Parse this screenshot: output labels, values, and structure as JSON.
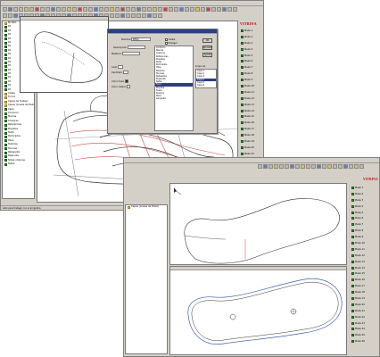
{
  "back_window": {
    "brand": "VITRINA",
    "tree": {
      "items": [
        {
          "label": "Modelo",
          "icon": "folder-icon"
        },
        {
          "label": "Pd",
          "icon": "layer-icon"
        },
        {
          "label": "Pd",
          "icon": "layer-icon"
        },
        {
          "label": "Pd",
          "icon": "layer-icon"
        },
        {
          "label": "Pd",
          "icon": "layer-icon"
        },
        {
          "label": "Pd",
          "icon": "layer-icon"
        },
        {
          "label": "Pd",
          "icon": "layer-icon"
        },
        {
          "label": "Pd",
          "icon": "layer-icon"
        },
        {
          "label": "Pd",
          "icon": "layer-icon"
        },
        {
          "label": "Pd",
          "icon": "layer-icon"
        },
        {
          "label": "Pd",
          "icon": "layer-icon"
        },
        {
          "label": "Pd",
          "icon": "layer-icon"
        },
        {
          "label": "Pd",
          "icon": "layer-icon"
        },
        {
          "label": "Pd",
          "icon": "layer-icon"
        },
        {
          "label": "Pd",
          "icon": "layer-icon"
        },
        {
          "label": "Pd",
          "icon": "layer-icon"
        },
        {
          "label": "Pd",
          "icon": "layer-icon"
        },
        {
          "label": "Pd",
          "icon": "layer-icon"
        },
        {
          "label": "Vistas",
          "icon": "folder-icon"
        },
        {
          "label": "Forros",
          "icon": "folder-icon"
        },
        {
          "label": "Capas de Trabajo",
          "icon": "folder-icon"
        },
        {
          "label": "Capas (Lineas de Pieza)",
          "icon": "folder-icon"
        },
        {
          "label": "Capa",
          "icon": "layer-icon"
        },
        {
          "label": "Contorno",
          "icon": "layer-icon"
        },
        {
          "label": "Marcas",
          "icon": "layer-icon"
        },
        {
          "label": "Costuras",
          "icon": "layer-icon"
        },
        {
          "label": "Referencias",
          "icon": "layer-icon"
        },
        {
          "label": "Piquetes",
          "icon": "layer-icon"
        },
        {
          "label": "Texto",
          "icon": "layer-icon"
        },
        {
          "label": "Perforados",
          "icon": "layer-icon"
        },
        {
          "label": "Hilos",
          "icon": "layer-icon"
        },
        {
          "label": "Taladros",
          "icon": "layer-icon"
        },
        {
          "label": "Tacones",
          "icon": "layer-icon"
        },
        {
          "label": "Rebajados",
          "icon": "layer-icon"
        },
        {
          "label": "Pespunte",
          "icon": "layer-icon"
        },
        {
          "label": "Notas internas",
          "icon": "layer-icon"
        },
        {
          "label": "Notas",
          "icon": "layer-icon"
        }
      ]
    },
    "right_panel": {
      "items": [
        "Pieza 1",
        "Pieza 2",
        "Pieza 3",
        "Pieza 4",
        "Pieza 5",
        "Pieza 6",
        "Pieza 7",
        "Pieza 8",
        "Pieza 9",
        "Pieza 10",
        "Pieza 11",
        "Pieza 12",
        "Pieza 13",
        "Pieza 14",
        "Pieza 15",
        "Pieza 16",
        "Pieza 17",
        "Pieza 18",
        "Pieza 19",
        "Pieza 20",
        "Pieza 21",
        "Pieza 22",
        "Pieza 23",
        "Pieza 24",
        "Pieza 25",
        "Pieza 26",
        "Pieza 27",
        "Pieza 28"
      ]
    },
    "status": "Listo para trabajar con el programa"
  },
  "dialog": {
    "fields": {
      "name_label": "Nombre",
      "name_value": "PIEZA",
      "desc_label": "Descripción",
      "material_label": "Material",
      "side_label": "Lado",
      "qty_label": "Cantidad",
      "color_label": "Color línea",
      "fill_label": "Color relleno"
    },
    "checks": {
      "visible": "Visible",
      "protect": "Proteger"
    },
    "buttons": {
      "ok": "OK",
      "cancel": "Cancelar",
      "help": "Ayuda"
    },
    "list": [
      "Contorno",
      "Marcas",
      "Costuras",
      "Referencias",
      "Piquetes",
      "Texto",
      "Perforados",
      "Hilos",
      "Taladros",
      "Tacones",
      "Rebajados",
      "Pespunte",
      "Notas",
      "Forro",
      "Plantilla",
      "Suela",
      "Puntera",
      "Talón",
      "Lengüeta"
    ],
    "list_selected_index": 13,
    "list2_label": "Grupo de",
    "list2": [
      "Capa 1",
      "Capa 2",
      "Capa 3",
      "Capa 4",
      "Capa 5",
      "Capa 6"
    ],
    "list2_selected_index": 3
  },
  "front_window": {
    "brand": "VITRINA",
    "tree_item": "Capas (Lineas de Pieza)",
    "right_panel": {
      "items": [
        "Pieza 1",
        "Pieza 2",
        "Pieza 3",
        "Pieza 4",
        "Pieza 5",
        "Pieza 6",
        "Pieza 7",
        "Pieza 8",
        "Pieza 9",
        "Pieza 10",
        "Pieza 11",
        "Pieza 12",
        "Pieza 13",
        "Pieza 14",
        "Pieza 15",
        "Pieza 16",
        "Pieza 17",
        "Pieza 18",
        "Pieza 19",
        "Pieza 20",
        "Pieza 21",
        "Pieza 22",
        "Pieza 23",
        "Pieza 24",
        "Pieza 25",
        "Pieza 26"
      ]
    }
  },
  "colors": {
    "window_bg": "#d4d0c8",
    "canvas_bg": "#ffffff",
    "brand": "#c00000",
    "pattern_red": "#c0504d",
    "pattern_dark": "#333333",
    "insole_blue": "#3a5fb0",
    "selection": "#2a3f86",
    "layer_icon": "#3a8c2f"
  }
}
